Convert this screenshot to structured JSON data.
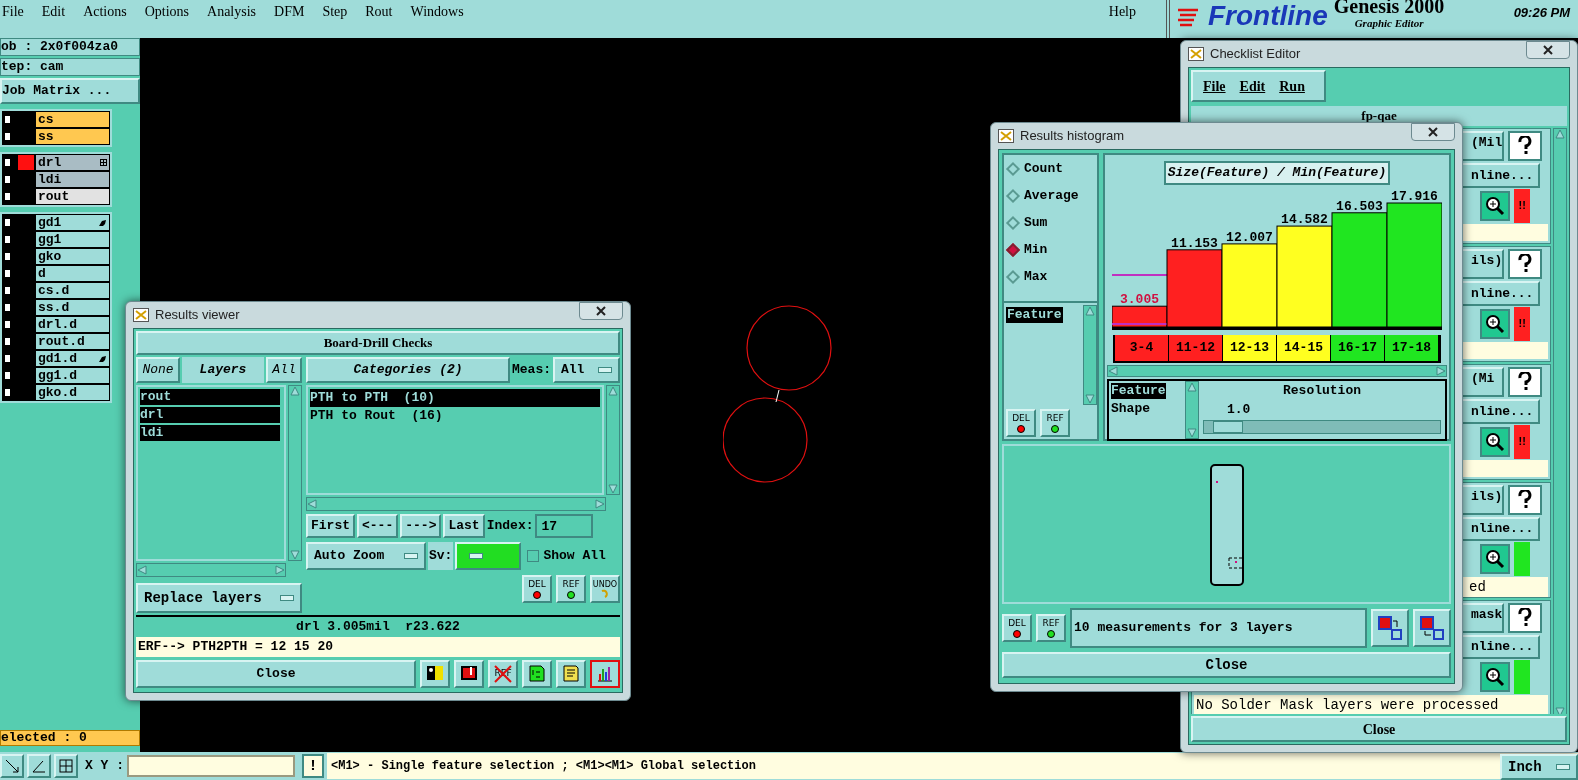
{
  "menubar": {
    "items": [
      "File",
      "Edit",
      "Actions",
      "Options",
      "Analysis",
      "DFM",
      "Step",
      "Rout",
      "Windows"
    ],
    "help": "Help"
  },
  "logo": {
    "product": "Genesis 2000",
    "brand": "Frontline",
    "subtitle": "Graphic Editor"
  },
  "clock": "09:26 PM",
  "left_panel": {
    "job": "ob : 2x0f004za0",
    "step": "tep: cam",
    "job_matrix_button": "Job Matrix ...",
    "layer_groups": [
      [
        {
          "name": "cs",
          "color": "#ffc850",
          "checked": false,
          "displayed": false,
          "kind": "plain"
        },
        {
          "name": "ss",
          "color": "#ffc850",
          "checked": false,
          "displayed": false,
          "kind": "plain"
        }
      ],
      [
        {
          "name": "drl",
          "color": "#a9bcc4",
          "checked": false,
          "displayed": true,
          "kind": "grid"
        },
        {
          "name": "ldi",
          "color": "#a9bcc4",
          "checked": false,
          "displayed": false,
          "kind": "plain"
        },
        {
          "name": "rout",
          "color": "#e2e2e2",
          "checked": false,
          "displayed": false,
          "kind": "plain"
        }
      ],
      [
        {
          "name": "gd1",
          "color": "#9fdcd9",
          "checked": false,
          "displayed": false,
          "kind": "hand"
        },
        {
          "name": "gg1",
          "color": "#9fdcd9",
          "checked": false,
          "displayed": false,
          "kind": "plain"
        },
        {
          "name": "gko",
          "color": "#9fdcd9",
          "checked": false,
          "displayed": false,
          "kind": "plain"
        },
        {
          "name": "d",
          "color": "#9fdcd9",
          "checked": false,
          "displayed": false,
          "kind": "plain"
        },
        {
          "name": "cs.d",
          "color": "#9fdcd9",
          "checked": false,
          "displayed": false,
          "kind": "plain"
        },
        {
          "name": "ss.d",
          "color": "#9fdcd9",
          "checked": false,
          "displayed": false,
          "kind": "plain"
        },
        {
          "name": "drl.d",
          "color": "#9fdcd9",
          "checked": false,
          "displayed": false,
          "kind": "plain"
        },
        {
          "name": "rout.d",
          "color": "#9fdcd9",
          "checked": false,
          "displayed": false,
          "kind": "plain"
        },
        {
          "name": "gd1.d",
          "color": "#9fdcd9",
          "checked": false,
          "displayed": false,
          "kind": "hand"
        },
        {
          "name": "gg1.d",
          "color": "#9fdcd9",
          "checked": false,
          "displayed": false,
          "kind": "plain"
        },
        {
          "name": "gko.d",
          "color": "#9fdcd9",
          "checked": false,
          "displayed": false,
          "kind": "plain"
        }
      ]
    ],
    "selected_count": "elected : 0"
  },
  "results_viewer": {
    "title": "Results viewer",
    "header": "Board-Drill Checks",
    "none_button": "None",
    "layers_label": "Layers",
    "all_button": "All",
    "layers": [
      {
        "name": "rout",
        "selected": true
      },
      {
        "name": "drl",
        "selected": true
      },
      {
        "name": "ldi",
        "selected": true
      }
    ],
    "categories_button": "Categories (2)",
    "meas_label": "Meas:",
    "meas_value": "All",
    "categories": [
      {
        "name": "PTH to PTH  (10)",
        "selected": true
      },
      {
        "name": "PTH to Rout  (16)",
        "selected": false
      }
    ],
    "nav_buttons": [
      "First",
      "<---",
      "--->",
      "Last"
    ],
    "index_label": "Index:",
    "index_value": "17",
    "zoom_mode": "Auto Zoom",
    "sv_label": "Sv:",
    "show_all": {
      "label": "Show All",
      "checked": false
    },
    "replace_mode": "Replace layers",
    "action_buttons": [
      {
        "kind": "del",
        "label": "DEL"
      },
      {
        "kind": "ref",
        "label": "REF"
      },
      {
        "kind": "undo",
        "label": "UNDO"
      }
    ],
    "measurement": "drl 3.005mil  r23.622",
    "erf_line": "ERF--> PTH2PTH = 12 15 20",
    "close": "Close",
    "tools": [
      {
        "kind": "figure",
        "selected": false
      },
      {
        "kind": "marker",
        "selected": false
      },
      {
        "kind": "ref-off",
        "label": "REF",
        "selected": false
      },
      {
        "kind": "half",
        "selected": false
      },
      {
        "kind": "note",
        "selected": false
      },
      {
        "kind": "chart",
        "selected": true
      }
    ]
  },
  "histogram": {
    "title": "Results histogram",
    "modes": [
      {
        "label": "Count",
        "selected": false
      },
      {
        "label": "Average",
        "selected": false
      },
      {
        "label": "Sum",
        "selected": false
      },
      {
        "label": "Min",
        "selected": true
      },
      {
        "label": "Max",
        "selected": false
      }
    ],
    "attributes": [
      {
        "label": "Feature",
        "selected": true
      }
    ],
    "left_buttons": [
      {
        "kind": "del",
        "label": "DEL"
      },
      {
        "kind": "ref",
        "label": "REF"
      }
    ],
    "chart_data": {
      "type": "bar",
      "title": "Size(Feature) / Min(Feature)",
      "categories": [
        "3-4",
        "11-12",
        "12-13",
        "14-15",
        "16-17",
        "17-18"
      ],
      "values": [
        3.005,
        11.153,
        12.007,
        14.582,
        16.503,
        17.916
      ],
      "data_labels": true
    },
    "bins": [
      {
        "color": "#ff2020",
        "highlighted": true
      },
      {
        "color": "#ff2020",
        "highlighted": false
      },
      {
        "color": "#ffff20",
        "highlighted": false
      },
      {
        "color": "#ffff20",
        "highlighted": false
      },
      {
        "color": "#20e620",
        "highlighted": false
      },
      {
        "color": "#20e620",
        "highlighted": false
      }
    ],
    "group_by": [
      {
        "label": "Feature",
        "selected": true
      },
      {
        "label": "Shape",
        "selected": false
      }
    ],
    "resolution_label": "Resolution",
    "resolution_value": "1.0",
    "resolution": {
      "level": 0.1
    },
    "bottom_buttons": [
      {
        "kind": "del",
        "label": "DEL"
      },
      {
        "kind": "ref",
        "label": "REF"
      }
    ],
    "status": "10 measurements for 3 layers",
    "close": "Close"
  },
  "checklist_editor": {
    "title": "Checklist Editor",
    "menu": [
      "File",
      "Edit",
      "Run"
    ],
    "name": "fp-qae",
    "actions": [
      {
        "name": "(Mil",
        "online": "nline...",
        "color": "#ff2020",
        "flag": "!!"
      },
      {
        "name": "ils)",
        "online": "nline...",
        "color": "#ff2020",
        "flag": "!!"
      },
      {
        "name": "(Mi",
        "online": "nline...",
        "color": "#ff2020",
        "flag": "!!"
      },
      {
        "name": "ils)",
        "online": "nline...",
        "color": "#20e620",
        "result": "ed"
      },
      {
        "name": "mask",
        "online": "nline...",
        "color": "#20e620",
        "result": "No Solder Mask layers were processed"
      }
    ],
    "close": "Close"
  },
  "bottom_bar": {
    "xy_label": "X Y :",
    "alert_button": "!",
    "message": "<M1> - Single feature selection ; <M1><M1> Global selection",
    "units": "Inch"
  }
}
